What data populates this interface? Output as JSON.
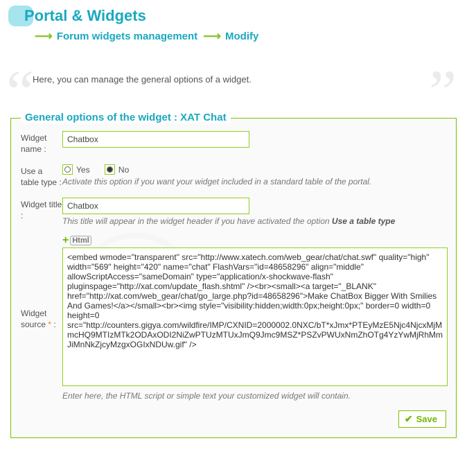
{
  "header": {
    "title": "Portal & Widgets",
    "breadcrumb": [
      "Forum widgets management",
      "Modify"
    ]
  },
  "intro": "Here, you can manage the general options of a widget.",
  "fieldset": {
    "legend": "General options of the widget : XAT Chat",
    "name": {
      "label": "Widget name :",
      "value": "Chatbox"
    },
    "table_type": {
      "label": "Use a table type :",
      "yes": "Yes",
      "no": "No",
      "selected": "no",
      "hint": "Activate this option if you want your widget included in a standard table of the portal."
    },
    "title": {
      "label": "Widget title :",
      "value": "Chatbox",
      "hint_prefix": "This title will appear in the widget header if you have activated the option ",
      "hint_bold": "Use a table type"
    },
    "source": {
      "label": "Widget source",
      "required_mark": "*",
      "badge": "Html",
      "value": "<embed wmode=\"transparent\" src=\"http://www.xatech.com/web_gear/chat/chat.swf\" quality=\"high\" width=\"569\" height=\"420\" name=\"chat\" FlashVars=\"id=48658296\" align=\"middle\" allowScriptAccess=\"sameDomain\" type=\"application/x-shockwave-flash\" pluginspage=\"http://xat.com/update_flash.shtml\" /><br><small><a target=\"_BLANK\" href=\"http://xat.com/web_gear/chat/go_large.php?id=48658296\">Make ChatBox Bigger With Smilies And Games!</a></small><br><img style=\"visibility:hidden;width:0px;height:0px;\" border=0 width=0 height=0 src=\"http://counters.gigya.com/wildfire/IMP/CXNID=2000002.0NXC/bT*xJmx*PTEyMzE5Njc4NjcxMjMmcHQ9MTIzMTk2ODAxODI2NiZwPTUzMTUxJmQ9Jmc9MSZ*PSZvPWUxNmZhOTg4YzYwMjRhMmJiMnNkZjcyMzgxOGIxNDUw.gif\" />",
      "hint": "Enter here, the HTML script or simple text your customized widget will contain."
    }
  },
  "buttons": {
    "save": "Save"
  }
}
